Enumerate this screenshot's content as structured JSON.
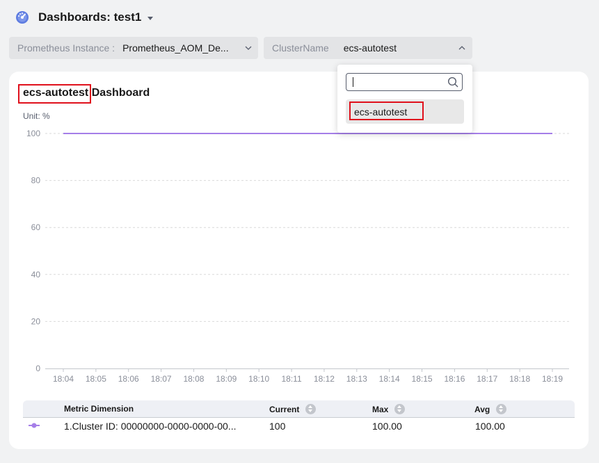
{
  "header": {
    "title": "Dashboards: test1",
    "icon": "dashboard-gauge-icon"
  },
  "filters": {
    "prometheus": {
      "label": "Prometheus Instance :",
      "value": "Prometheus_AOM_De..."
    },
    "cluster": {
      "label": "ClusterName",
      "value": "ecs-autotest"
    }
  },
  "dashboard": {
    "title_highlight": "ecs-autotest",
    "title_rest": "Dashboard",
    "unit": "Unit: %"
  },
  "dropdown": {
    "search_value": "",
    "options": [
      "ecs-autotest"
    ],
    "highlight_color": "#e0101c"
  },
  "chart_data": {
    "type": "line",
    "x": [
      "18:04",
      "18:05",
      "18:06",
      "18:07",
      "18:08",
      "18:09",
      "18:10",
      "18:11",
      "18:12",
      "18:13",
      "18:14",
      "18:15",
      "18:16",
      "18:17",
      "18:18",
      "18:19"
    ],
    "series": [
      {
        "values": [
          100,
          100,
          100,
          100,
          100,
          100,
          100,
          100,
          100,
          100,
          100,
          100,
          100,
          100,
          100,
          100
        ],
        "color": "#a57ee8"
      }
    ],
    "yticks": [
      0,
      20,
      40,
      60,
      80,
      100
    ],
    "ylim": [
      0,
      100
    ],
    "grid": true,
    "ylabel": "Unit: %"
  },
  "table": {
    "columns": [
      "Metric Dimension",
      "Current",
      "Max",
      "Avg"
    ],
    "rows": [
      {
        "dimension": "1.Cluster ID: 00000000-0000-0000-00...",
        "current": "100",
        "max": "100.00",
        "avg": "100.00",
        "color": "#a57ee8"
      }
    ]
  },
  "colors": {
    "accent": "#a57ee8",
    "highlight": "#e0101c",
    "background": "#f1f2f3"
  }
}
